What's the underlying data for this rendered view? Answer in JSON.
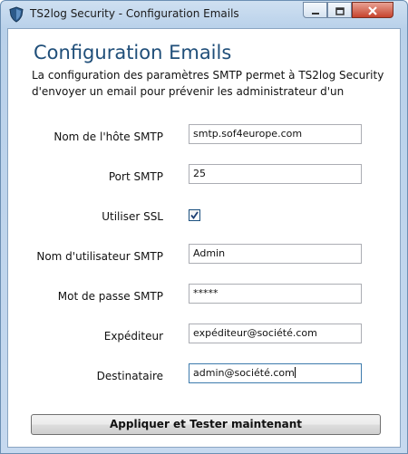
{
  "window": {
    "title": "TS2log Security - Configuration Emails"
  },
  "page": {
    "heading": "Configuration Emails",
    "description": "La configuration des paramètres SMTP permet à TS2log Security d'envoyer un email pour prévenir les administrateur d'un"
  },
  "form": {
    "host": {
      "label": "Nom de l'hôte SMTP",
      "value": "smtp.sof4europe.com"
    },
    "port": {
      "label": "Port SMTP",
      "value": "25"
    },
    "ssl": {
      "label": "Utiliser SSL",
      "checked": true
    },
    "username": {
      "label": "Nom d'utilisateur SMTP",
      "value": "Admin"
    },
    "password": {
      "label": "Mot de passe SMTP",
      "value": "*****"
    },
    "sender": {
      "label": "Expéditeur",
      "value": "expéditeur@société.com"
    },
    "recipient": {
      "label": "Destinataire",
      "value": "admin@société.com"
    }
  },
  "actions": {
    "apply_label": "Appliquer et Tester maintenant"
  },
  "colors": {
    "heading": "#1f4e79",
    "window_frame": "#b9d1ea",
    "close_button": "#c7432d"
  }
}
